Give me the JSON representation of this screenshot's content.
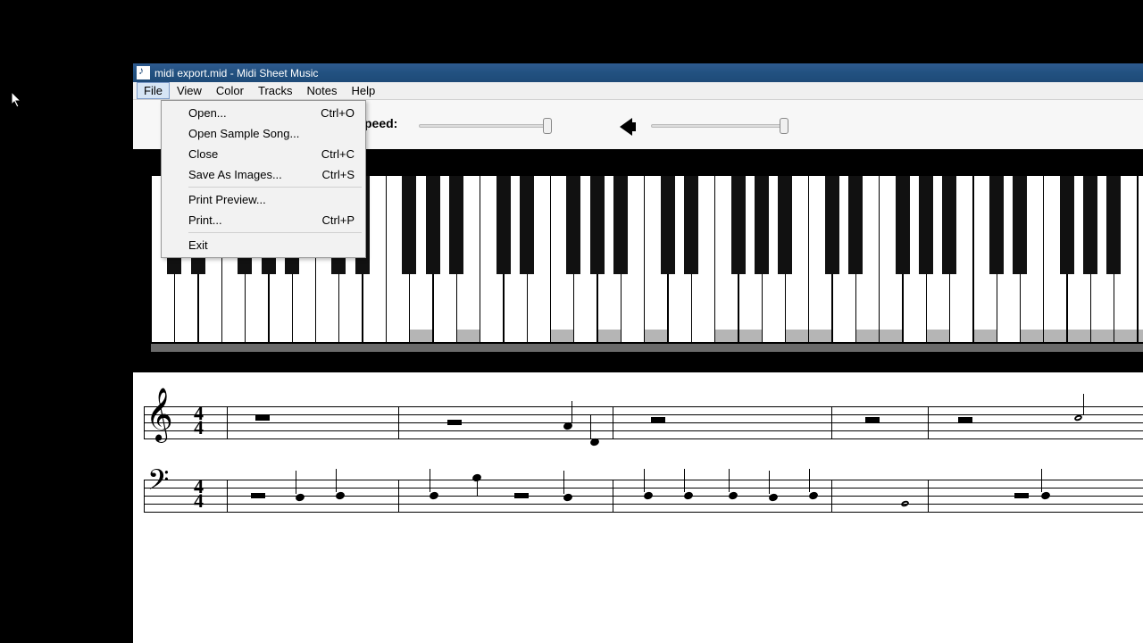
{
  "titlebar": {
    "title": "midi export.mid - Midi Sheet Music"
  },
  "menubar": {
    "items": [
      "File",
      "View",
      "Color",
      "Tracks",
      "Notes",
      "Help"
    ],
    "active_index": 0
  },
  "file_menu": {
    "items": [
      {
        "label": "Open...",
        "shortcut": "Ctrl+O"
      },
      {
        "label": "Open Sample Song...",
        "shortcut": ""
      },
      {
        "label": "Close",
        "shortcut": "Ctrl+C"
      },
      {
        "label": "Save As Images...",
        "shortcut": "Ctrl+S"
      },
      {
        "sep": true
      },
      {
        "label": "Print Preview...",
        "shortcut": ""
      },
      {
        "label": "Print...",
        "shortcut": "Ctrl+P"
      },
      {
        "sep": true
      },
      {
        "label": "Exit",
        "shortcut": ""
      }
    ]
  },
  "toolbar": {
    "speed_label": "peed:"
  },
  "sheet": {
    "time_signature": {
      "top": "4",
      "bottom": "4"
    }
  }
}
